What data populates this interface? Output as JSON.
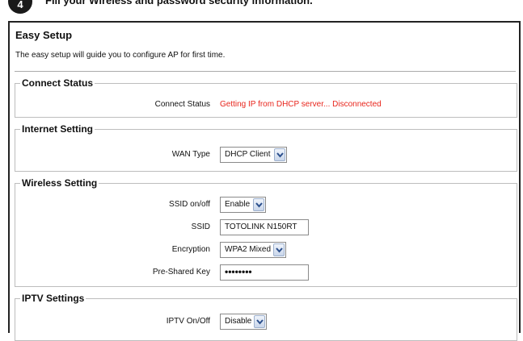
{
  "header": {
    "step_number": "4",
    "cut_text": "Fill your Wireless and password security information."
  },
  "page": {
    "title": "Easy Setup",
    "description": "The easy setup will guide you to configure AP for first time."
  },
  "connect_status": {
    "legend": "Connect Status",
    "label": "Connect Status",
    "value": "Getting IP from DHCP server... Disconnected",
    "value_color": "#e8251c"
  },
  "internet": {
    "legend": "Internet Setting",
    "wan_label": "WAN Type",
    "wan_value": "DHCP Client"
  },
  "wireless": {
    "legend": "Wireless Setting",
    "ssid_onoff_label": "SSID on/off",
    "ssid_onoff_value": "Enable",
    "ssid_label": "SSID",
    "ssid_value": "TOTOLINK N150RT",
    "encryption_label": "Encryption",
    "encryption_value": "WPA2 Mixed",
    "psk_label": "Pre-Shared Key",
    "psk_value": "••••••••"
  },
  "iptv": {
    "legend": "IPTV Settings",
    "label": "IPTV On/Off",
    "value": "Disable"
  },
  "icons": {
    "dropdown": "chevron-down-icon"
  }
}
